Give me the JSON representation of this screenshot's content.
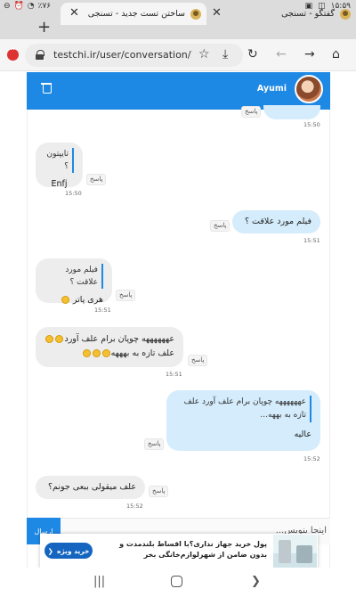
{
  "status_bar": {
    "time": "۱۵:۵۹",
    "battery": "٪۷۶"
  },
  "tabs": [
    {
      "title": "گفتگو - تسنجی",
      "active": true
    },
    {
      "title": "ساختن تست جدید - تسنجی",
      "active": false
    }
  ],
  "address_bar": {
    "url": "testchi.ir/user/conversation/165("
  },
  "chat": {
    "username": "Ayumi",
    "messages": [
      {
        "id": "m0",
        "dir": "out",
        "text": "",
        "reply_label": "پاسخ",
        "time": "15:50"
      },
      {
        "id": "m1",
        "dir": "in",
        "quote": "تایپتون ؟",
        "text": "Enfj",
        "reply_label": "پاسخ",
        "time": "15:50"
      },
      {
        "id": "m2",
        "dir": "out",
        "text": "فیلم مورد علاقت ؟",
        "reply_label": "پاسخ",
        "time": "15:51"
      },
      {
        "id": "m3",
        "dir": "in",
        "quote": "فیلم مورد علاقت ؟",
        "text": "هری پاتر",
        "reply_label": "پاسخ",
        "time": "15:51"
      },
      {
        "id": "m4",
        "dir": "in",
        "line1": "عههههههه چوپان برام علف آورد",
        "line2": "علف تازه به بهههه",
        "reply_label": "پاسخ",
        "time": "15:51"
      },
      {
        "id": "m5",
        "dir": "out",
        "quote": "عههههههه چوپان برام علف آورد علف تازه به بههه...",
        "text": "عالیه",
        "reply_label": "پاسخ",
        "time": "15:52"
      },
      {
        "id": "m6",
        "dir": "in",
        "text": "علف میقولی ببعی جونم؟",
        "reply_label": "پاسخ",
        "time": "15:52"
      }
    ],
    "input": {
      "placeholder": "اینجا بنویس..."
    },
    "send_label": "ارسال"
  },
  "ad": {
    "text": "پول خرید جهاز نداری؟با اقساط بلندمدت و بدون ضامن از شهرلوازم‌خانگی بخر",
    "button": "خرید ویژه"
  },
  "colors": {
    "accent": "#1e88e5",
    "incoming_bubble": "#ededed",
    "outgoing_bubble": "#d4ecfb"
  }
}
